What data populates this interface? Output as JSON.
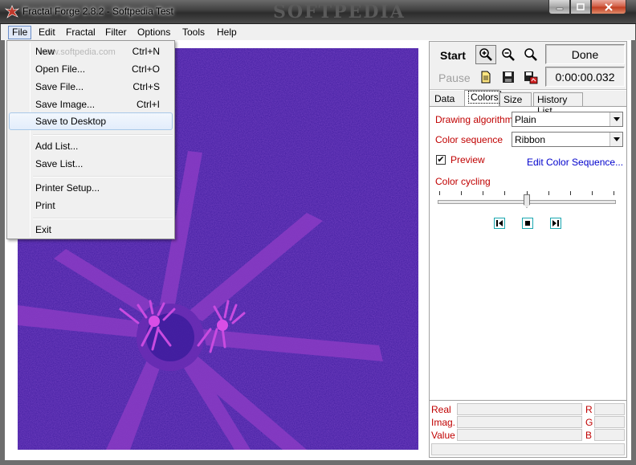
{
  "window": {
    "title": "Fractal Forge 2.8.2 - Softpedia Test",
    "watermark": "SOFTPEDIA"
  },
  "menubar": [
    {
      "label": "File"
    },
    {
      "label": "Edit"
    },
    {
      "label": "Fractal"
    },
    {
      "label": "Filter"
    },
    {
      "label": "Options"
    },
    {
      "label": "Tools"
    },
    {
      "label": "Help"
    }
  ],
  "file_menu": {
    "watermark": "www.softpedia.com",
    "items": [
      {
        "label": "New",
        "shortcut": "Ctrl+N"
      },
      {
        "label": "Open File...",
        "shortcut": "Ctrl+O"
      },
      {
        "label": "Save File...",
        "shortcut": "Ctrl+S"
      },
      {
        "label": "Save Image...",
        "shortcut": "Ctrl+I"
      },
      {
        "label": "Save to Desktop",
        "shortcut": ""
      },
      {
        "label": "Add List...",
        "shortcut": ""
      },
      {
        "label": "Save List...",
        "shortcut": ""
      },
      {
        "label": "Printer Setup...",
        "shortcut": ""
      },
      {
        "label": "Print",
        "shortcut": ""
      },
      {
        "label": "Exit",
        "shortcut": ""
      }
    ],
    "highlighted": "Save to Desktop"
  },
  "controls": {
    "start_label": "Start",
    "pause_label": "Pause",
    "status": "Done",
    "elapsed": "0:00:00.032"
  },
  "tabs": [
    {
      "label": "Data"
    },
    {
      "label": "Colors"
    },
    {
      "label": "Size"
    },
    {
      "label": "History List"
    }
  ],
  "active_tab": "Colors",
  "colors_tab": {
    "drawing_algorithm_label": "Drawing algorithm",
    "drawing_algorithm_value": "Plain",
    "color_sequence_label": "Color sequence",
    "color_sequence_value": "Ribbon",
    "preview_label": "Preview",
    "preview_checked": true,
    "edit_link": "Edit Color Sequence...",
    "color_cycling_label": "Color cycling",
    "slider_level": 0.5
  },
  "info": {
    "real_label": "Real",
    "imag_label": "Imag.",
    "value_label": "Value",
    "r_label": "R",
    "g_label": "G",
    "b_label": "B"
  },
  "colors": {
    "canvas_base": "#3f1c9e",
    "fractal_arm": "#8a3bc4",
    "label_red": "#c00000",
    "link_blue": "#0000cc"
  }
}
